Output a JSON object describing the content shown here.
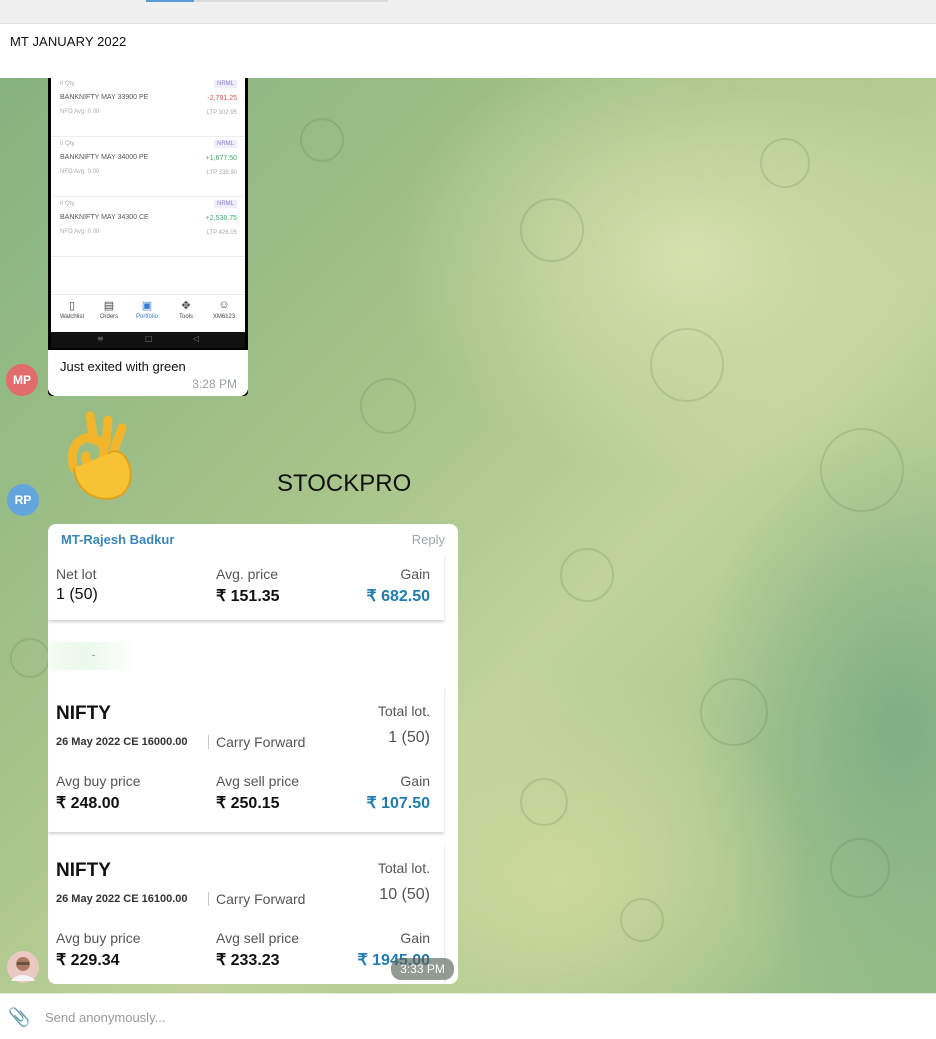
{
  "header": {
    "title": "MT JANUARY 2022"
  },
  "message1": {
    "screenshot": {
      "positions": [
        {
          "qty": "0 Qty.",
          "tag": "NRML",
          "name": "BANKNIFTY MAY 33900 PE",
          "pnl": "-2,791.25",
          "pnl_color": "#e05252",
          "meta": "NFO  Avg. 0.00",
          "ltp": "LTP 302.95"
        },
        {
          "qty": "0 Qty.",
          "tag": "NRML",
          "name": "BANKNIFTY MAY 34000 PE",
          "pnl": "+1,677.50",
          "pnl_color": "#3caa6e",
          "meta": "NFO  Avg. 0.00",
          "ltp": "LTP 338.90"
        },
        {
          "qty": "0 Qty.",
          "tag": "NRML",
          "name": "BANKNIFTY MAY 34300 CE",
          "pnl": "+2,538.75",
          "pnl_color": "#3caa6e",
          "meta": "NFO  Avg. 0.00",
          "ltp": "LTP 426.05"
        }
      ],
      "nav": [
        {
          "icon": "bookmark-icon",
          "label": "Watchlist"
        },
        {
          "icon": "orders-icon",
          "label": "Orders"
        },
        {
          "icon": "briefcase-icon",
          "label": "Portfolio",
          "active": true
        },
        {
          "icon": "wrench-icon",
          "label": "Tools"
        },
        {
          "icon": "user-icon",
          "label": "XM6123"
        }
      ]
    },
    "caption": "Just exited with green",
    "time": "3:28 PM",
    "avatar": {
      "initials": "MP",
      "color": "#e06c6c"
    }
  },
  "emoji": "ok-hand-icon",
  "overlay_text": "STOCKPRO",
  "avatar_rp": {
    "initials": "RP",
    "color": "#62a6dd"
  },
  "message2": {
    "sender": "MT-Rajesh Badkur",
    "reply": "Reply",
    "summary": {
      "net_lot_label": "Net lot",
      "net_lot_value": "1 (50)",
      "avg_price_label": "Avg. price",
      "avg_price_value": "₹ 151.35",
      "gain_label": "Gain",
      "gain_value": "₹ 682.50"
    },
    "trades": [
      {
        "symbol": "NIFTY",
        "contract": "26 May 2022 CE 16000.00",
        "product": "Carry Forward",
        "total_lot_label": "Total lot.",
        "total_lot_value": "1 (50)",
        "avg_buy_label": "Avg buy price",
        "avg_buy_value": "₹ 248.00",
        "avg_sell_label": "Avg sell price",
        "avg_sell_value": "₹ 250.15",
        "gain_label": "Gain",
        "gain_value": "₹ 107.50"
      },
      {
        "symbol": "NIFTY",
        "contract": "26 May 2022 CE 16100.00",
        "product": "Carry Forward",
        "total_lot_label": "Total lot.",
        "total_lot_value": "10 (50)",
        "avg_buy_label": "Avg buy price",
        "avg_buy_value": "₹ 229.34",
        "avg_sell_label": "Avg sell price",
        "avg_sell_value": "₹ 233.23",
        "gain_label": "Gain",
        "gain_value": "₹ 1945.00"
      }
    ],
    "time": "3:33 PM"
  },
  "composer": {
    "placeholder": "Send anonymously..."
  }
}
